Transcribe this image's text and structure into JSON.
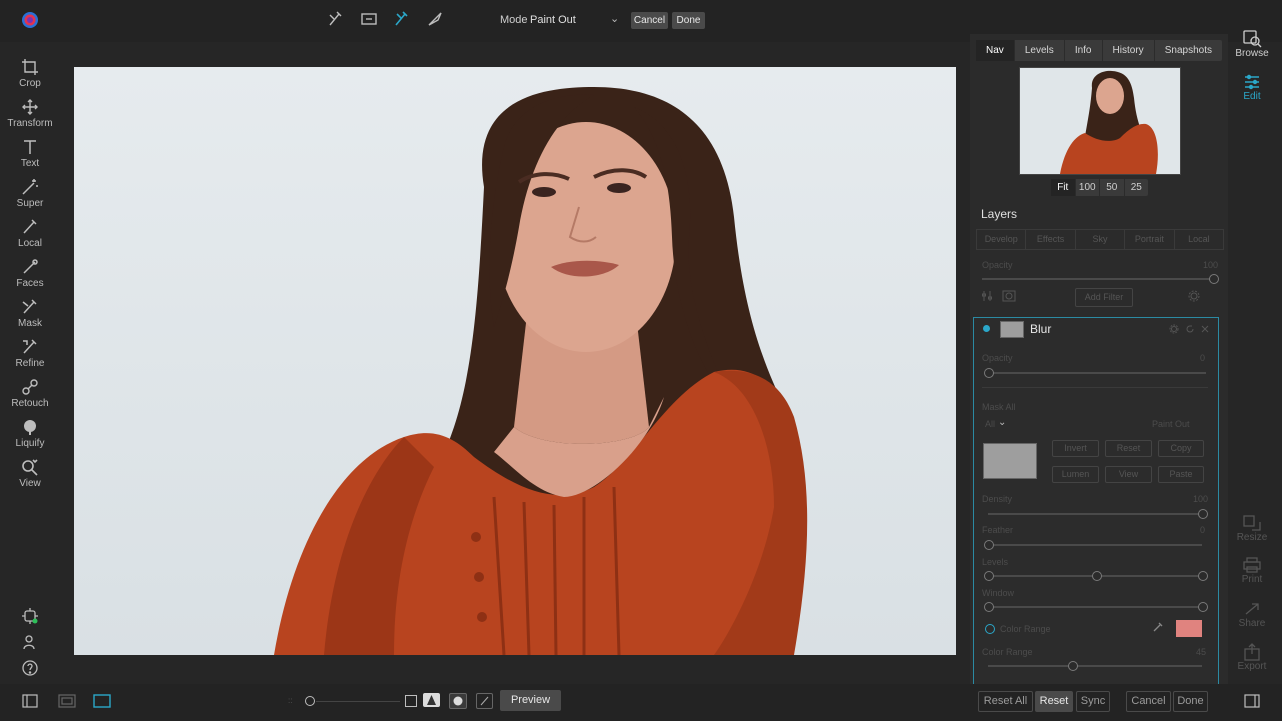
{
  "topbar": {
    "mode_label": "Mode",
    "mode_value": "Paint Out",
    "cancel_label": "Cancel",
    "done_label": "Done"
  },
  "left_tools": [
    {
      "label": "Crop",
      "icon": "crop-icon"
    },
    {
      "label": "Transform",
      "icon": "move-icon"
    },
    {
      "label": "Text",
      "icon": "text-icon"
    },
    {
      "label": "Super",
      "icon": "magic-wand-icon"
    },
    {
      "label": "Local",
      "icon": "local-brush-icon"
    },
    {
      "label": "Faces",
      "icon": "faces-brush-icon"
    },
    {
      "label": "Mask",
      "icon": "mask-brush-icon"
    },
    {
      "label": "Refine",
      "icon": "refine-brush-icon"
    },
    {
      "label": "Retouch",
      "icon": "retouch-icon"
    },
    {
      "label": "Liquify",
      "icon": "liquify-icon"
    },
    {
      "label": "View",
      "icon": "zoom-icon"
    }
  ],
  "nav_tabs": [
    "Nav",
    "Levels",
    "Info",
    "History",
    "Snapshots"
  ],
  "zoom_options": [
    "Fit",
    "100",
    "50",
    "25"
  ],
  "layers": {
    "title": "Layers",
    "filter_tabs": [
      "Develop",
      "Effects",
      "Sky",
      "Portrait",
      "Local"
    ],
    "opacity_label": "Opacity",
    "opacity_value": "100",
    "add_filter_label": "Add Filter"
  },
  "blur": {
    "title": "Blur",
    "opacity_label": "Opacity",
    "opacity_value": "0",
    "mask_all_label": "Mask All",
    "mask_all_value": "All",
    "paint_out_label": "Paint Out",
    "mask_buttons": [
      "Invert",
      "Reset",
      "Copy",
      "Lumen",
      "View",
      "Paste"
    ],
    "density_label": "Density",
    "density_value": "100",
    "feather_label": "Feather",
    "feather_value": "0",
    "levels_label": "Levels",
    "window_label": "Window",
    "color_range_label": "Color Range",
    "color_range_label2": "Color Range",
    "color_range_value": "45",
    "swatch_color": "#e0837f"
  },
  "right_strip": {
    "browse_label": "Browse",
    "edit_label": "Edit",
    "resize_label": "Resize",
    "print_label": "Print",
    "share_label": "Share",
    "export_label": "Export"
  },
  "bottom": {
    "preview_label": "Preview",
    "reset_all_label": "Reset All",
    "reset_label": "Reset",
    "sync_label": "Sync",
    "cancel_label": "Cancel",
    "done_label": "Done"
  },
  "colors": {
    "accent": "#2ba7c9",
    "dress": "#b8441f",
    "hair": "#3a2318",
    "sky": "#dfe5e8"
  }
}
